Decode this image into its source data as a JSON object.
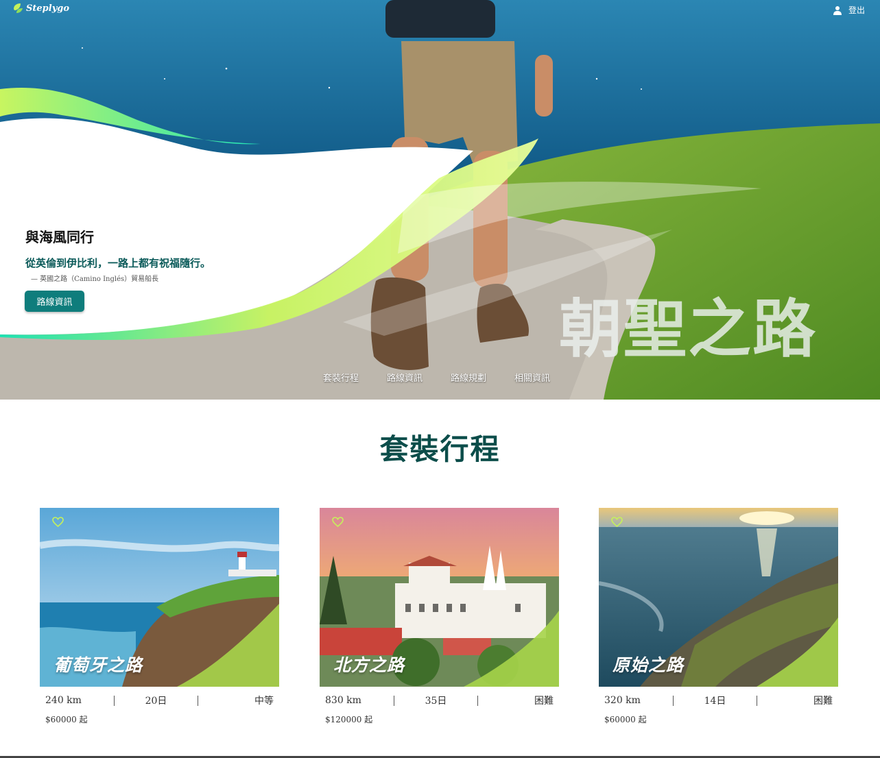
{
  "header": {
    "logo_text": "Steplygo",
    "login_label": "登出"
  },
  "hero": {
    "title": "與海風同行",
    "subtitle": "從英倫到伊比利，一路上都有祝福隨行。",
    "citation": "— 英國之路（Camino Inglés）貿易船長",
    "button_label": "路線資訊",
    "big_title": "朝聖之路",
    "nav": [
      "套裝行程",
      "路線資訊",
      "路線規劃",
      "相關資訊"
    ]
  },
  "section": {
    "title": "套裝行程"
  },
  "cards": [
    {
      "name": "葡萄牙之路",
      "distance": "240 km",
      "days": "20日",
      "difficulty": "中等",
      "price": "$60000 起"
    },
    {
      "name": "北方之路",
      "distance": "830 km",
      "days": "35日",
      "difficulty": "困難",
      "price": "$120000 起"
    },
    {
      "name": "原始之路",
      "distance": "320 km",
      "days": "14日",
      "difficulty": "困難",
      "price": "$60000 起"
    }
  ],
  "icons": {
    "logo": "leaf-logo-icon",
    "user": "user-icon",
    "favorite": "heart-outline-icon"
  },
  "colors": {
    "accent": "#0f7d7c",
    "title_green": "#0b4d4a",
    "wave_green": "#c6f25a",
    "wave_teal": "#14e0b0"
  }
}
